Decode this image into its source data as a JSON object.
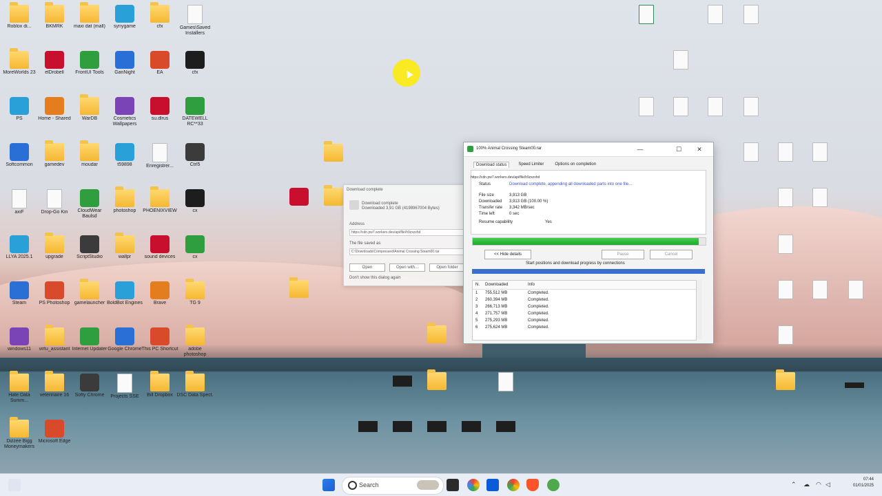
{
  "idm_window": {
    "title": "100% Animal Crossing Steam00.rar",
    "minimize": "—",
    "maximize": "☐",
    "close": "✕",
    "tabs": [
      "Download status",
      "Speed Limiter",
      "Options on completion"
    ],
    "url": "https://cdn.pw7.workers.dev/api/file/h9zxzxhd",
    "status_label": "Status",
    "status_value": "Download complete, appending all downloaded parts into one file...",
    "file_size_label": "File size",
    "file_size_value": "3,913 GB",
    "downloaded_label": "Downloaded",
    "downloaded_value": "3,913 GB (100.00 %)",
    "transfer_rate_label": "Transfer rate",
    "transfer_rate_value": "3,342 MB/sec",
    "time_left_label": "Time left",
    "time_left_value": "0 sec",
    "resume_label": "Resume capability",
    "resume_value": "Yes",
    "progress": 0.97,
    "hide_details": "<< Hide details",
    "pause": "Pause",
    "cancel": "Cancel",
    "connections_label": "Start positions and download progress by connections",
    "table_headers": [
      "N.",
      "Downloaded",
      "Info"
    ],
    "rows": [
      {
        "n": "1",
        "downloaded": "755,512 MB",
        "info": "Completed."
      },
      {
        "n": "2",
        "downloaded": "260,394 MB",
        "info": "Completed."
      },
      {
        "n": "3",
        "downloaded": "266,713 MB",
        "info": "Completed."
      },
      {
        "n": "4",
        "downloaded": "271,757 MB",
        "info": "Completed."
      },
      {
        "n": "5",
        "downloaded": "275,293 MB",
        "info": "Completed."
      },
      {
        "n": "6",
        "downloaded": "275,624 MB",
        "info": "Completed."
      }
    ]
  },
  "back_dialog": {
    "title": "Download complete",
    "line1": "Download complete",
    "line2": "Downloaded 3,91 GB (4198967004 Bytes)",
    "address_label": "Address",
    "address_value": "https://cdn.pw7.workers.dev/api/file/h9zxzxhd",
    "saved_label": "The file saved as",
    "saved_value": "C:\\Downloads\\Compressed\\Animal Crossing Steam00.rar",
    "open": "Open",
    "open_with": "Open with...",
    "open_folder": "Open folder",
    "dont_show": "Don't show this dialog again"
  },
  "desktop_icons": [
    {
      "label": "Roblox di...",
      "kind": "folder"
    },
    {
      "label": "BKMRK",
      "kind": "folder"
    },
    {
      "label": "maxi dat (mall)",
      "kind": "folder"
    },
    {
      "label": "synygame",
      "kind": "app"
    },
    {
      "label": "cfx",
      "kind": "folder"
    },
    {
      "label": "Games\\Saved Installers",
      "kind": "doc"
    },
    {
      "label": "MoreWorlds 23",
      "kind": "folder"
    },
    {
      "label": "elDrobell",
      "kind": "app"
    },
    {
      "label": "FrontUI Tools",
      "kind": "app"
    },
    {
      "label": "GanNight",
      "kind": "app"
    },
    {
      "label": "EA",
      "kind": "app"
    },
    {
      "label": "cfx",
      "kind": "app"
    },
    {
      "label": "PS",
      "kind": "app"
    },
    {
      "label": "Home - Shared",
      "kind": "app"
    },
    {
      "label": "WarDB",
      "kind": "folder"
    },
    {
      "label": "Cosmetics Wallpapers",
      "kind": "app"
    },
    {
      "label": "su.dlrus",
      "kind": "app"
    },
    {
      "label": "DATEWELL RC**33",
      "kind": "app"
    },
    {
      "label": "Softcommon",
      "kind": "app"
    },
    {
      "label": "gamedev",
      "kind": "folder"
    },
    {
      "label": "moudar",
      "kind": "folder"
    },
    {
      "label": "t59898",
      "kind": "app"
    },
    {
      "label": "Enregistrer...",
      "kind": "doc"
    },
    {
      "label": "Ctrl5",
      "kind": "app"
    },
    {
      "label": "axiF",
      "kind": "doc"
    },
    {
      "label": "Drop-Go Kin",
      "kind": "doc"
    },
    {
      "label": "CloudWear Baulsd",
      "kind": "app"
    },
    {
      "label": "photoshop",
      "kind": "folder"
    },
    {
      "label": "PHOENIXVIEW",
      "kind": "folder"
    },
    {
      "label": "cx",
      "kind": "app"
    },
    {
      "label": "LLYA 2025.1",
      "kind": "app"
    },
    {
      "label": "upgrade",
      "kind": "folder"
    },
    {
      "label": "ScriptStudio",
      "kind": "app"
    },
    {
      "label": "wallpr",
      "kind": "folder"
    },
    {
      "label": "sound devices",
      "kind": "app"
    },
    {
      "label": "cx",
      "kind": "app"
    },
    {
      "label": "Steam",
      "kind": "app"
    },
    {
      "label": "PS Photoshop",
      "kind": "app"
    },
    {
      "label": "gamelauncher",
      "kind": "folder"
    },
    {
      "label": "BoldBot Engines",
      "kind": "app"
    },
    {
      "label": "Brave",
      "kind": "app"
    },
    {
      "label": "TG 9",
      "kind": "folder"
    },
    {
      "label": "windows11",
      "kind": "app"
    },
    {
      "label": "virtu_assistant",
      "kind": "folder"
    },
    {
      "label": "Internet Updater",
      "kind": "app"
    },
    {
      "label": "Google Chrome",
      "kind": "app"
    },
    {
      "label": "This PC Shortcut",
      "kind": "app"
    },
    {
      "label": "adobe photoshop",
      "kind": "folder"
    },
    {
      "label": "Hate Data Summ...",
      "kind": "folder"
    },
    {
      "label": "veterinaire 16",
      "kind": "folder"
    },
    {
      "label": "Softy Chrome",
      "kind": "app"
    },
    {
      "label": "Projects SSE",
      "kind": "doc"
    },
    {
      "label": "Bill Dropbox",
      "kind": "folder"
    },
    {
      "label": "DSC Data Spect.",
      "kind": "folder"
    },
    {
      "label": "Dizzee Bigg Moneymakers",
      "kind": "folder"
    },
    {
      "label": "Microsoft Edge",
      "kind": "app"
    }
  ],
  "taskbar": {
    "search_placeholder": "Search",
    "time": "07:44",
    "date": "01/01/2025"
  }
}
